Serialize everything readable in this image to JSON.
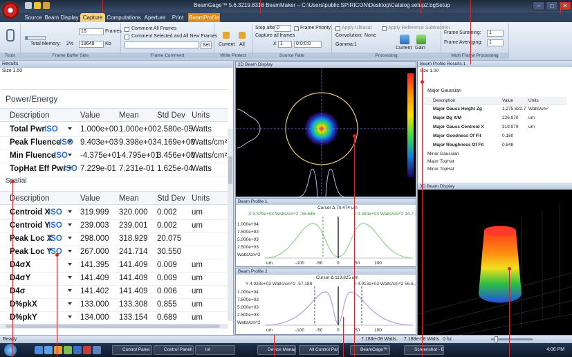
{
  "window": {
    "title": "BeamGage™ 5.6.3219.8318 BeamMaker – C:\\Users\\public.SPIRICON\\Desktop\\Catalog setup2.bgSetup"
  },
  "tabs": [
    {
      "label": "Source"
    },
    {
      "label": "Beam Display"
    },
    {
      "label": "Capture"
    },
    {
      "label": "Computations"
    },
    {
      "label": "Aperture"
    },
    {
      "label": "Print"
    },
    {
      "label": "BeamProfile"
    }
  ],
  "ribbon": {
    "tools_label": "Tools",
    "frame_buffer": {
      "frames": "16",
      "frames_unit": "Frames",
      "total_memory_label": "Total Memory:",
      "memory_pct": "2%",
      "memory_kb": "19648",
      "kb_unit": "Kb",
      "label": "Frame Buffer Size"
    },
    "frame_comment": {
      "comment_all": "Comment All Frames",
      "comment_selected": "Comment Selected and All New Frames",
      "set_label": "Set",
      "label": "Frame Comment"
    },
    "write_protect": {
      "current": "Current",
      "all": "All",
      "label": "Write Protect"
    },
    "source_rate": {
      "stop_after_label": "Stop after:",
      "stop_after": "0",
      "frame_priority": "Frame Priority",
      "capture_all": "Capture all frames",
      "x_label": "X",
      "x_value": "1",
      "time_value": "0:0:0:0",
      "label": "Source Rate"
    },
    "processing": {
      "apply_ultracal": "Apply Ultracal",
      "apply_reference": "Apply Reference Subtraction",
      "convolution_label": "Convolution:",
      "convolution": "None",
      "gamma_label": "Gamma:",
      "gamma": "1",
      "current": "Current",
      "gain": "Gain",
      "label": "Processing"
    },
    "multi_frame": {
      "summing_label": "Frame Summing:",
      "summing": "1",
      "averaging_label": "Frame Averaging:",
      "averaging": "1",
      "label": "Multi Frame Processing"
    }
  },
  "results": {
    "panel_title": "Results",
    "size_label": "Size 1.50",
    "power_section": "Power/Energy",
    "spatial_section": "Spatial",
    "columns": [
      "Description",
      "Value",
      "Mean",
      "Std Dev",
      "Units"
    ],
    "power_rows": [
      {
        "desc": "Total Pwr",
        "iso": "ISO",
        "value": "1.000e+00",
        "mean": "1.000e+00",
        "std": "2.580e-05",
        "units": "Watts"
      },
      {
        "desc": "Peak Fluence",
        "iso": "ISO",
        "value": "9.403e+03",
        "mean": "9.398e+03",
        "std": "4.169e+00",
        "units": "Watts/cm²"
      },
      {
        "desc": "Min Fluence",
        "iso": "ISO",
        "value": "-4.375e+01",
        "mean": "-4.795e+01",
        "std": "3.456e+00",
        "units": "Watts/cm²"
      },
      {
        "desc": "TopHat Eff Pwr",
        "iso": "ISO",
        "value": "7.229e-01",
        "mean": "7.231e-01",
        "std": "1.625e-04",
        "units": "Watts"
      }
    ],
    "spatial_rows": [
      {
        "desc": "Centroid X",
        "iso": "ISO",
        "value": "319.999",
        "mean": "320.000",
        "std": "0.002",
        "units": "um"
      },
      {
        "desc": "Centroid Y",
        "iso": "ISO",
        "value": "239.003",
        "mean": "239.001",
        "std": "0.002",
        "units": "um"
      },
      {
        "desc": "Peak Loc X",
        "iso": "ISO",
        "value": "298.000",
        "mean": "318.929",
        "std": "20.075",
        "units": ""
      },
      {
        "desc": "Peak Loc Y",
        "iso": "ISO",
        "value": "267.000",
        "mean": "241.714",
        "std": "30.550",
        "units": ""
      },
      {
        "desc": "D4σX",
        "iso": "",
        "value": "141.395",
        "mean": "141.409",
        "std": "0.009",
        "units": "um"
      },
      {
        "desc": "D4σY",
        "iso": "",
        "value": "141.409",
        "mean": "141.409",
        "std": "0.009",
        "units": "um"
      },
      {
        "desc": "D4σ",
        "iso": "",
        "value": "141.402",
        "mean": "141.409",
        "std": "0.006",
        "units": "um"
      },
      {
        "desc": "D%pkX",
        "iso": "",
        "value": "133.000",
        "mean": "133.308",
        "std": "0.855",
        "units": "um"
      },
      {
        "desc": "D%pkY",
        "iso": "",
        "value": "134.000",
        "mean": "133.154",
        "std": "0.689",
        "units": "um"
      }
    ]
  },
  "beam_display_2d": {
    "title": "2D Beam Display"
  },
  "beam_profile_1": {
    "title": "Beam Profile 1",
    "cursor": "Cursor Δ 70.474 um",
    "left_readout": "X 9.375e+03 Watts/cm^2 -35.686",
    "right_readout": "X 9.384e+03 Watts/cm^2 34.7..",
    "yticks": [
      "1.000e+04",
      "7.500e+03",
      "5.000e+03",
      "2.500e+03",
      "Watts/cm^2"
    ],
    "xticks": [
      "um",
      "-100",
      "-50",
      "0",
      "50",
      "100"
    ]
  },
  "beam_profile_2": {
    "title": "Beam Profile 2",
    "cursor": "Cursor Δ 113.825 um",
    "left_readout": "Y 4.928e+03 Watts/cm^2 -57.188",
    "right_readout": "Y 4.913e+03 Watts/cm^2 56.6..",
    "yticks": [
      "1.000e+04",
      "7.500e+03",
      "5.000e+03",
      "2.500e+03",
      "Watts/cm^2"
    ],
    "xticks": [
      "um",
      "-100",
      "-50",
      "0",
      "50",
      "100"
    ]
  },
  "profile_results": {
    "title": "Beam Profile Results 1",
    "size_label": "Size 1.00",
    "major_gaussian": "Major Gaussian",
    "columns": [
      "Description",
      "Value",
      "Units"
    ],
    "rows": [
      {
        "desc": "Major Gauss Height Zg",
        "value": "1,275.833.7",
        "units": "Watts/cm²"
      },
      {
        "desc": "Major Dg X/M",
        "value": "226.970",
        "units": "um"
      },
      {
        "desc": "Major Gauss Centroid X",
        "value": "319.979",
        "units": "um"
      },
      {
        "desc": "Major Goodness Of Fit",
        "value": "0.180",
        "units": ""
      },
      {
        "desc": "Major Roughness Of Fit",
        "value": "0.848",
        "units": ""
      }
    ],
    "sub_items": [
      "Minor Gaussian",
      "Major TopHat",
      "Minor TopHat"
    ]
  },
  "beam_display_3d": {
    "title": "3D Beam Display"
  },
  "status": {
    "ready": "Ready",
    "power1": "7.188e-08 Watts",
    "power2": "7.188e-08 Watts",
    "hz": "0 hz"
  },
  "taskbar": {
    "items": [
      "Control Panel",
      "Control Panel\\...",
      "lot",
      "Device Manager",
      "All Control Pan...",
      "BeamGage™ 5.6",
      "Screenshot - Bea..."
    ],
    "clock": "4:06 PM"
  }
}
